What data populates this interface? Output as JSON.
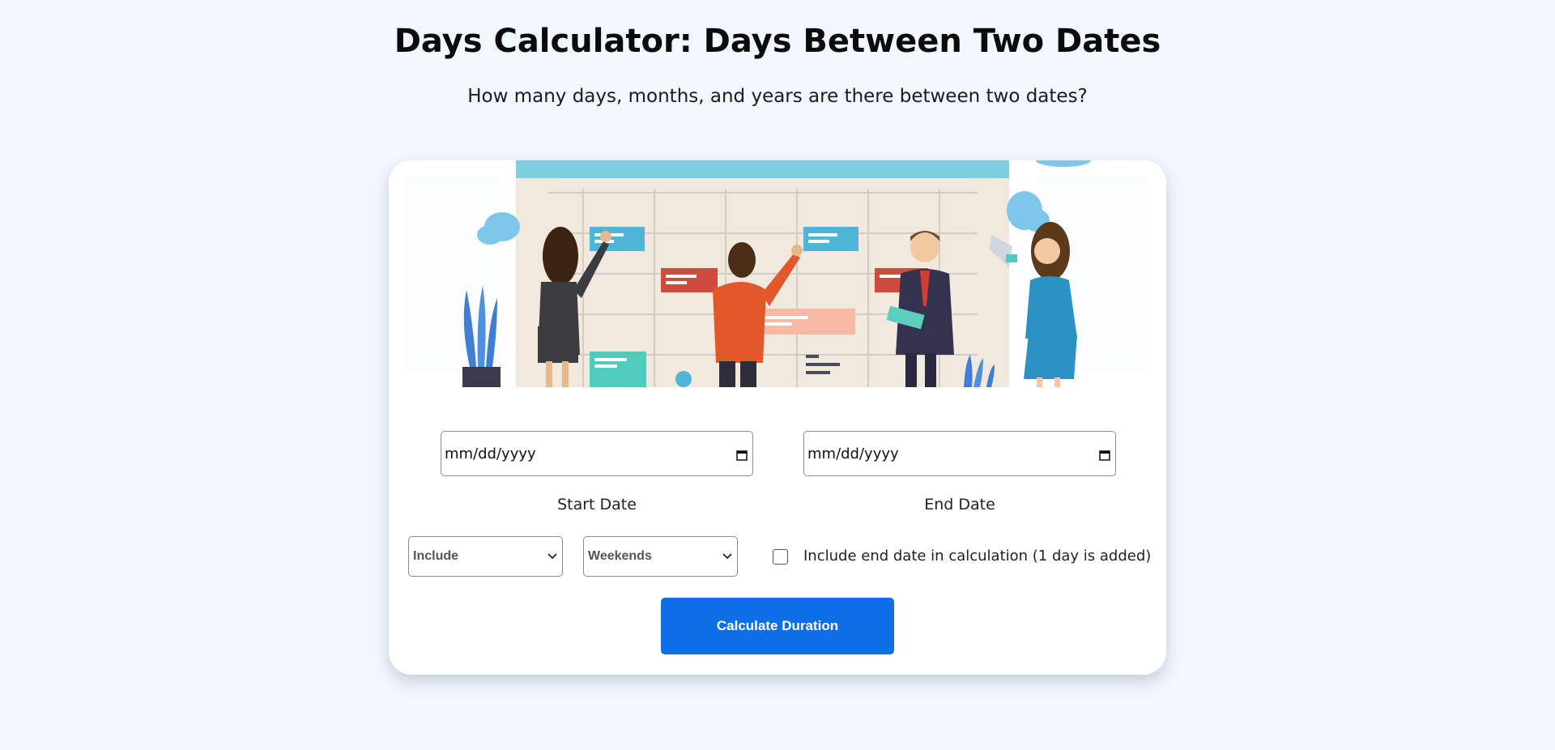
{
  "header": {
    "title": "Days Calculator: Days Between Two Dates",
    "subtitle": "How many days, months, and years are there between two dates?"
  },
  "form": {
    "start_date": {
      "placeholder": "mm/dd/yyyy",
      "label": "Start Date",
      "icon": "calendar-icon"
    },
    "end_date": {
      "placeholder": "mm/dd/yyyy",
      "label": "End Date",
      "icon": "calendar-icon"
    },
    "include_select": {
      "value": "Include",
      "icon": "chevron-down-icon"
    },
    "weekends_select": {
      "value": "Weekends",
      "icon": "chevron-down-icon"
    },
    "include_end_date": {
      "checked": false,
      "label": "Include end date in calculation (1 day is added)"
    },
    "calculate_button": {
      "label": "Calculate Duration"
    }
  },
  "colors": {
    "background": "#f2f7fd",
    "card": "#ffffff",
    "button": "#0d6fe7",
    "button_text": "#ffffff"
  }
}
